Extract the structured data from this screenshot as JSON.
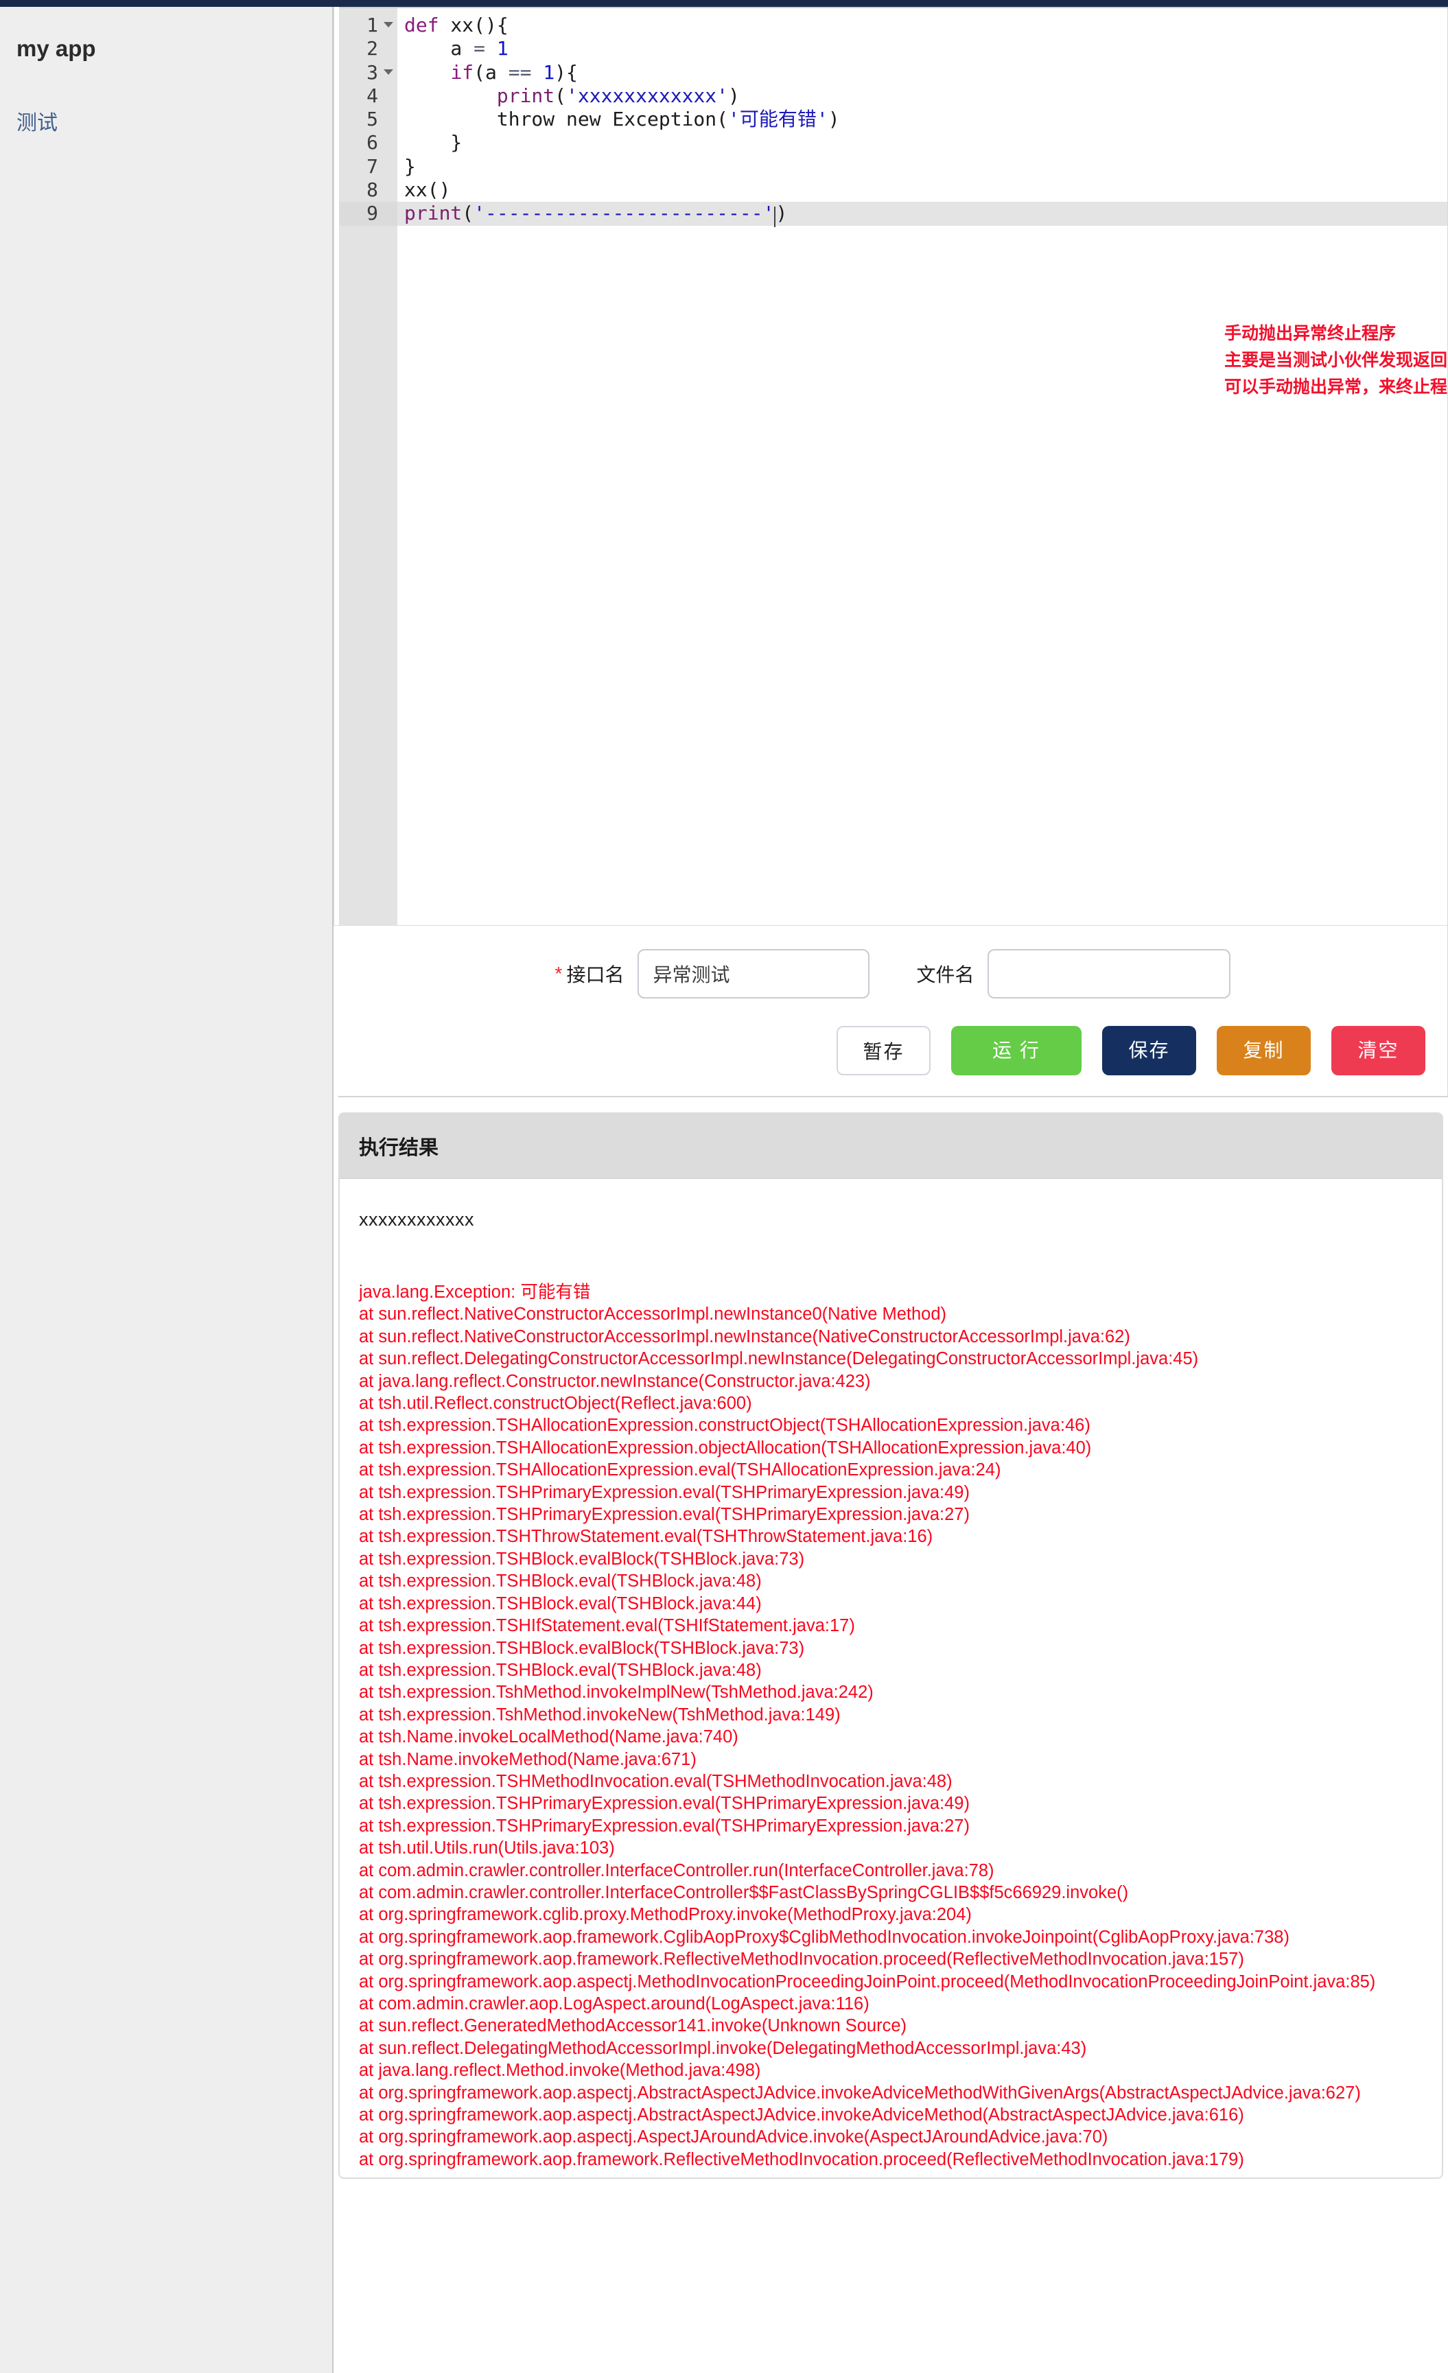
{
  "app": {
    "brand": "my app",
    "nav": [
      {
        "label": "测试",
        "name": "sidebar-item-test"
      }
    ]
  },
  "editor": {
    "language": "tsh/java-like",
    "active_line": 9,
    "total_lines": 9,
    "gutter_numbers": [
      "1",
      "2",
      "3",
      "4",
      "5",
      "6",
      "7",
      "8",
      "9"
    ],
    "foldable_lines": [
      1,
      3
    ],
    "lines": [
      {
        "n": "1",
        "tokens": [
          {
            "t": "def",
            "c": "kw"
          },
          {
            "t": " xx(){",
            "c": "plain"
          }
        ]
      },
      {
        "n": "2",
        "tokens": [
          {
            "t": "    a ",
            "c": "plain"
          },
          {
            "t": "=",
            "c": "op"
          },
          {
            "t": " ",
            "c": "plain"
          },
          {
            "t": "1",
            "c": "num"
          }
        ]
      },
      {
        "n": "3",
        "tokens": [
          {
            "t": "    ",
            "c": "plain"
          },
          {
            "t": "if",
            "c": "kw"
          },
          {
            "t": "(a ",
            "c": "plain"
          },
          {
            "t": "==",
            "c": "op"
          },
          {
            "t": " ",
            "c": "plain"
          },
          {
            "t": "1",
            "c": "num"
          },
          {
            "t": "){",
            "c": "plain"
          }
        ]
      },
      {
        "n": "4",
        "tokens": [
          {
            "t": "        ",
            "c": "plain"
          },
          {
            "t": "print",
            "c": "fn"
          },
          {
            "t": "(",
            "c": "plain"
          },
          {
            "t": "'xxxxxxxxxxxx'",
            "c": "str"
          },
          {
            "t": ")",
            "c": "plain"
          }
        ]
      },
      {
        "n": "5",
        "tokens": [
          {
            "t": "        throw new Exception(",
            "c": "plain"
          },
          {
            "t": "'可能有错'",
            "c": "str"
          },
          {
            "t": ")",
            "c": "plain"
          }
        ]
      },
      {
        "n": "6",
        "tokens": [
          {
            "t": "    }",
            "c": "plain"
          }
        ]
      },
      {
        "n": "7",
        "tokens": [
          {
            "t": "}",
            "c": "plain"
          }
        ]
      },
      {
        "n": "8",
        "tokens": [
          {
            "t": "xx()",
            "c": "plain"
          }
        ]
      },
      {
        "n": "9",
        "tokens": [
          {
            "t": "print",
            "c": "fn"
          },
          {
            "t": "(",
            "c": "plain"
          },
          {
            "t": "'------------------------'",
            "c": "str"
          },
          {
            "t": ")",
            "c": "plain"
          }
        ]
      }
    ],
    "annotation": {
      "color": "#f2102c",
      "lines": [
        "手动抛出异常终止程序",
        "主要是当测试小伙伴发现返回的结果不是预期的结果时",
        "可以手动抛出异常，来终止程序的执行"
      ]
    }
  },
  "form": {
    "interface_name": {
      "required_mark": "*",
      "label": "接口名",
      "value": "异常测试",
      "placeholder": ""
    },
    "file_name": {
      "label": "文件名",
      "value": "",
      "placeholder": ""
    },
    "buttons": [
      {
        "label": "暂存",
        "name": "draft-button",
        "color": "#ffffff"
      },
      {
        "label": "运 行",
        "name": "run-button",
        "color": "#65cc47"
      },
      {
        "label": "保存",
        "name": "save-button",
        "color": "#153060"
      },
      {
        "label": "复制",
        "name": "copy-button",
        "color": "#d9821b"
      },
      {
        "label": "清空",
        "name": "clear-button",
        "color": "#ef3b52"
      }
    ]
  },
  "result": {
    "title": "执行结果",
    "stdout": "xxxxxxxxxxxx",
    "exception_color": "#f8071e",
    "exception_header": "java.lang.Exception: 可能有错",
    "stack_lines": [
      "at sun.reflect.NativeConstructorAccessorImpl.newInstance0(Native Method)",
      "at sun.reflect.NativeConstructorAccessorImpl.newInstance(NativeConstructorAccessorImpl.java:62)",
      "at sun.reflect.DelegatingConstructorAccessorImpl.newInstance(DelegatingConstructorAccessorImpl.java:45)",
      "at java.lang.reflect.Constructor.newInstance(Constructor.java:423)",
      "at tsh.util.Reflect.constructObject(Reflect.java:600)",
      "at tsh.expression.TSHAllocationExpression.constructObject(TSHAllocationExpression.java:46)",
      "at tsh.expression.TSHAllocationExpression.objectAllocation(TSHAllocationExpression.java:40)",
      "at tsh.expression.TSHAllocationExpression.eval(TSHAllocationExpression.java:24)",
      "at tsh.expression.TSHPrimaryExpression.eval(TSHPrimaryExpression.java:49)",
      "at tsh.expression.TSHPrimaryExpression.eval(TSHPrimaryExpression.java:27)",
      "at tsh.expression.TSHThrowStatement.eval(TSHThrowStatement.java:16)",
      "at tsh.expression.TSHBlock.evalBlock(TSHBlock.java:73)",
      "at tsh.expression.TSHBlock.eval(TSHBlock.java:48)",
      "at tsh.expression.TSHBlock.eval(TSHBlock.java:44)",
      "at tsh.expression.TSHIfStatement.eval(TSHIfStatement.java:17)",
      "at tsh.expression.TSHBlock.evalBlock(TSHBlock.java:73)",
      "at tsh.expression.TSHBlock.eval(TSHBlock.java:48)",
      "at tsh.expression.TshMethod.invokeImplNew(TshMethod.java:242)",
      "at tsh.expression.TshMethod.invokeNew(TshMethod.java:149)",
      "at tsh.Name.invokeLocalMethod(Name.java:740)",
      "at tsh.Name.invokeMethod(Name.java:671)",
      "at tsh.expression.TSHMethodInvocation.eval(TSHMethodInvocation.java:48)",
      "at tsh.expression.TSHPrimaryExpression.eval(TSHPrimaryExpression.java:49)",
      "at tsh.expression.TSHPrimaryExpression.eval(TSHPrimaryExpression.java:27)",
      "at tsh.util.Utils.run(Utils.java:103)",
      "at com.admin.crawler.controller.InterfaceController.run(InterfaceController.java:78)",
      "at com.admin.crawler.controller.InterfaceController$$FastClassBySpringCGLIB$$f5c66929.invoke()",
      "at org.springframework.cglib.proxy.MethodProxy.invoke(MethodProxy.java:204)",
      "at org.springframework.aop.framework.CglibAopProxy$CglibMethodInvocation.invokeJoinpoint(CglibAopProxy.java:738)",
      "at org.springframework.aop.framework.ReflectiveMethodInvocation.proceed(ReflectiveMethodInvocation.java:157)",
      "at org.springframework.aop.aspectj.MethodInvocationProceedingJoinPoint.proceed(MethodInvocationProceedingJoinPoint.java:85)",
      "at com.admin.crawler.aop.LogAspect.around(LogAspect.java:116)",
      "at sun.reflect.GeneratedMethodAccessor141.invoke(Unknown Source)",
      "at sun.reflect.DelegatingMethodAccessorImpl.invoke(DelegatingMethodAccessorImpl.java:43)",
      "at java.lang.reflect.Method.invoke(Method.java:498)",
      "at org.springframework.aop.aspectj.AbstractAspectJAdvice.invokeAdviceMethodWithGivenArgs(AbstractAspectJAdvice.java:627)",
      "at org.springframework.aop.aspectj.AbstractAspectJAdvice.invokeAdviceMethod(AbstractAspectJAdvice.java:616)",
      "at org.springframework.aop.aspectj.AspectJAroundAdvice.invoke(AspectJAroundAdvice.java:70)",
      "at org.springframework.aop.framework.ReflectiveMethodInvocation.proceed(ReflectiveMethodInvocation.java:179)"
    ]
  },
  "theme": {
    "top_bar": "#1b2a4a",
    "sidebar_bg": "#eeeeee",
    "nav_link": "#3f5d8c",
    "gutter_bg": "#e3e3e3",
    "active_line_bg": "#e4e4e4"
  }
}
